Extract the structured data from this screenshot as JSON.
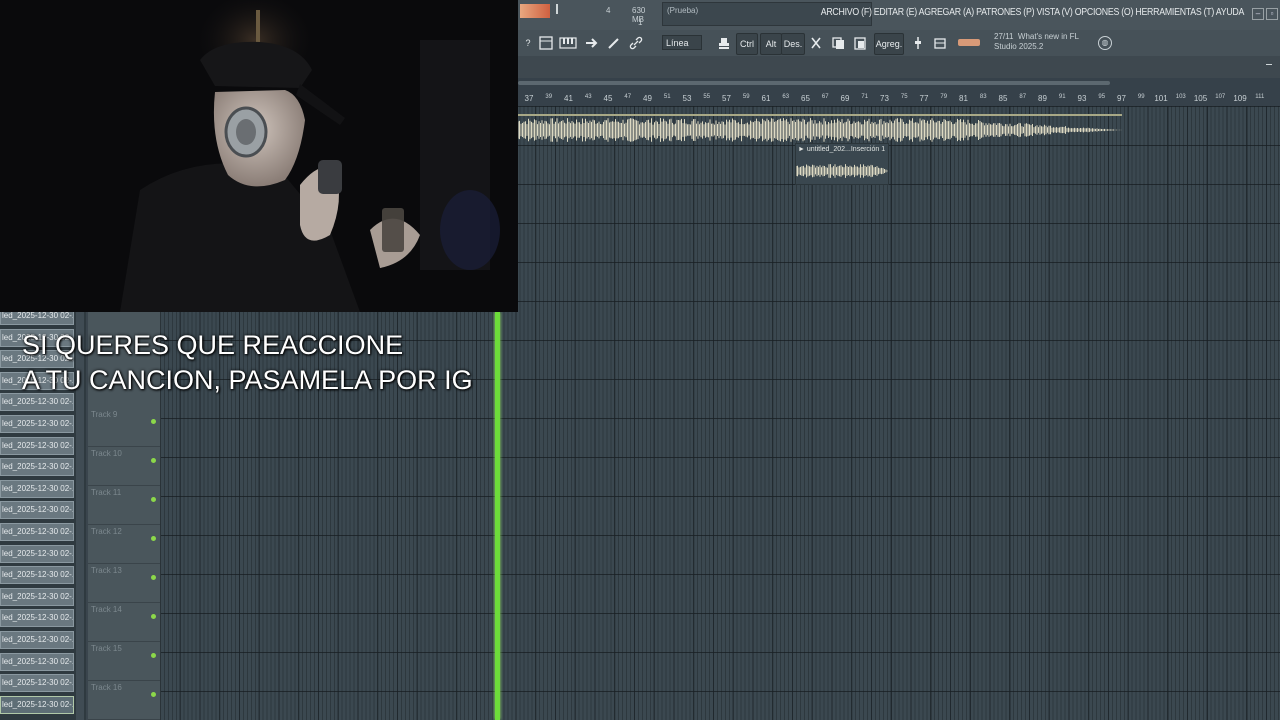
{
  "menu_bar": {
    "items": [
      "ARCHIVO (F)",
      "EDITAR (E)",
      "AGREGAR (A)",
      "PATRONES (P)",
      "VISTA (V)",
      "OPCIONES (O)",
      "HERRAMIENTAS (T)",
      "AYUDA"
    ],
    "minimize_glyph": "–",
    "restore_glyph": "▫",
    "memory": "630 MB",
    "cpu_value": "4",
    "poly_value": "1",
    "hint_text": "(Prueba)"
  },
  "toolbar": {
    "help": "?",
    "snap": "Línea",
    "ctrl": "Ctrl",
    "alt": "Alt",
    "des": "Des.",
    "agreg": "Agreg.",
    "news_counter": "27/11",
    "news_line1": "What's new in FL",
    "news_line2": "Studio 2025.2"
  },
  "ruler": {
    "labels": [
      "37",
      "39",
      "41",
      "43",
      "45",
      "47",
      "49",
      "51",
      "53",
      "55",
      "57",
      "59",
      "61",
      "63",
      "65",
      "67",
      "69",
      "71",
      "73",
      "75",
      "77",
      "79",
      "81",
      "83",
      "85",
      "87",
      "89",
      "91",
      "93",
      "95",
      "97",
      "99",
      "101",
      "103",
      "105",
      "107",
      "109",
      "111"
    ]
  },
  "clips": {
    "small_clip_title": "► untitled_202...Inserción 1"
  },
  "browser": {
    "items": [
      "led_2025-12-30 02-...",
      "led_2025-12-30 02-...",
      "led_2025-12-30 02-...",
      "led_2025-12-30 02-...",
      "led_2025-12-30 02-...",
      "led_2025-12-30 02-...",
      "led_2025-12-30 02-...",
      "led_2025-12-30 02-...",
      "led_2025-12-30 02-...",
      "led_2025-12-30 02-...",
      "led_2025-12-30 02-...",
      "led_2025-12-30 02-...",
      "led_2025-12-30 02-...",
      "led_2025-12-30 02-...",
      "led_2025-12-30 02-...",
      "led_2025-12-30 02-...",
      "led_2025-12-30 02-...",
      "led_2025-12-30 02-...",
      "led_2025-12-30 02-..."
    ]
  },
  "tracks": {
    "labels": [
      "Track 9",
      "Track 10",
      "Track 11",
      "Track 12",
      "Track 13",
      "Track 14",
      "Track 15",
      "Track 16"
    ]
  },
  "overlay": {
    "subtitle_line1": "SI QUERES QUE REACCIONE",
    "subtitle_line2": "A TU CANCION, PASAMELA POR IG"
  },
  "colors": {
    "playhead": "#6ddc3a",
    "waveform": "#ddd9c2",
    "grid_bg": "#3b4850"
  }
}
